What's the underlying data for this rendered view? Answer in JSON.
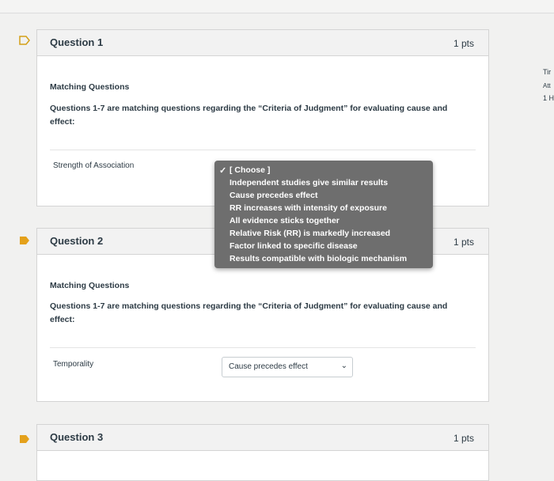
{
  "questions": [
    {
      "title": "Question 1",
      "points": "1 pts",
      "heading": "Matching Questions",
      "description": "Questions 1-7 are matching questions regarding the “Criteria of Judgment” for evaluating cause and effect:",
      "match_label": "Strength of Association"
    },
    {
      "title": "Question 2",
      "points": "1 pts",
      "heading": "Matching Questions",
      "description": "Questions 1-7 are matching questions regarding the “Criteria of Judgment” for evaluating cause and effect:",
      "match_label": "Temporality",
      "selected": "Cause precedes effect"
    },
    {
      "title": "Question 3",
      "points": "1 pts"
    }
  ],
  "dropdown": {
    "check_icon": "checkmark-icon",
    "options": [
      "[ Choose ]",
      "Independent studies give similar results",
      "Cause precedes effect",
      "RR increases with intensity of exposure",
      "All evidence sticks together",
      "Relative Risk (RR) is markedly increased",
      "Factor linked to specific disease",
      "Results compatible with biologic mechanism"
    ]
  },
  "side_panel": {
    "line1": "Tir",
    "line2": "Att",
    "line3": "1 H"
  },
  "colors": {
    "flag_outline": "#d4a017",
    "flag_filled": "#e4a11b",
    "dropdown_bg": "#6e6e6e"
  }
}
